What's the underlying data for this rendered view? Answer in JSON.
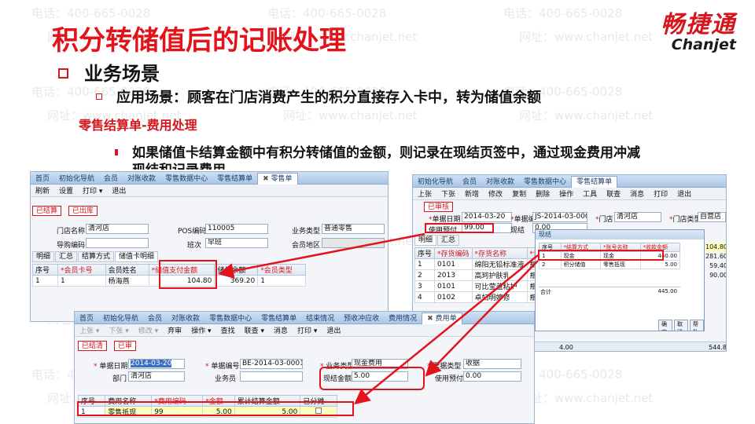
{
  "slide": {
    "title": "积分转储值后的记账处理",
    "section_heading": "业务场景",
    "scenario": "应用场景：顾客在门店消费产生的积分直接存入卡中，转为储值余额",
    "subheading": "零售结算单-费用处理",
    "note_line1": "如果储值卡结算金额中有积分转储值的金额，则记录在现结页签中，通过现金费用冲减",
    "note_line2": "现结和记录费用。"
  },
  "logo": {
    "cn": "畅捷通",
    "en": "Chanjet"
  },
  "watermark": {
    "phone": "电话：400-665-0028",
    "web": "网址：www.chanjet.net"
  },
  "win1": {
    "tabs": [
      "首页",
      "初始化导航",
      "会员",
      "对账收款",
      "零售数据中心",
      "零售结算单",
      "零售单"
    ],
    "close_mark": "✖",
    "toolbar": [
      "刷新",
      "设置",
      "打印 ▾",
      "退出"
    ],
    "stamps": [
      "已结算",
      "已出库"
    ],
    "labels": {
      "store": "门店名称",
      "guide": "导购编码",
      "pos": "POS编码",
      "shift": "班次",
      "biz": "业务类型",
      "member": "会员地区"
    },
    "values": {
      "store": "清河店",
      "pos": "110005",
      "shift": "早班",
      "biz": "普通零售"
    },
    "subtabs": [
      "明细",
      "汇总",
      "结算方式",
      "储值卡明细"
    ],
    "grid_headers": [
      "序号",
      "*会员卡号",
      "会员姓名",
      "*储值支付金额",
      "储值余额",
      "*会员类型"
    ],
    "grid_row": [
      "1",
      "1",
      "杨海燕",
      "104.80",
      "369.20",
      "1"
    ]
  },
  "win2": {
    "tabs": [
      "首页",
      "初始化导航",
      "会员",
      "对账收款",
      "零售数据中心",
      "零售结算单",
      "结束情况",
      "预收冲应收",
      "费用情况",
      "费用单"
    ],
    "toolbar": [
      "上张 ▾",
      "下张 ▾",
      "修改 ▾",
      "弃审",
      "操作 ▾",
      "查找",
      "联查 ▾",
      "消息",
      "打印 ▾",
      "退出"
    ],
    "stamps": [
      "已结清",
      "已审"
    ],
    "labels": {
      "date": "单据日期",
      "dept": "部门",
      "code": "单据编号",
      "staff": "业务员",
      "biz": "业务类型",
      "settle": "现结金额",
      "bill": "票据类型",
      "prepay": "使用预付"
    },
    "values": {
      "date": "2014-03-20",
      "dept": "清河店",
      "code": "BE-2014-03-0001",
      "biz": "现金费用",
      "settle": "5.00",
      "bill": "收据",
      "prepay": "0.00"
    },
    "grid_headers": [
      "序号",
      "费用名称",
      "*费用编码",
      "*金额",
      "累计结算金额",
      "已分摊"
    ],
    "grid_row": [
      "1",
      "零售抵现",
      "99",
      "5.00",
      "5.00",
      ""
    ]
  },
  "win3": {
    "tabs": [
      "初始化导航",
      "会员",
      "对账收款",
      "零售数据中心",
      "零售结算单"
    ],
    "toolbar": [
      "上张",
      "下张",
      "新增",
      "修改",
      "复制",
      "删除",
      "操作",
      "工具",
      "联查",
      "消息",
      "打印",
      "退出"
    ],
    "stamps": [
      "已审核"
    ],
    "labels": {
      "date": "单据日期",
      "code": "单据编号",
      "store": "门店",
      "pay": "使用预付",
      "settle": "现结",
      "shop_type": "门店类型"
    },
    "values": {
      "date": "2014-03-20",
      "code": "JS-2014-03-0005",
      "store": "清河店",
      "pay": "99.00",
      "settle": "0.00",
      "shop_type": "自营店"
    },
    "subtabs": [
      "明细",
      "汇总"
    ],
    "grid_headers": [
      "序号",
      "*存货编码",
      "*存货名称",
      "*计量单位"
    ],
    "grid_rows": [
      [
        "1",
        "0101",
        "绵阳无铅标准液",
        "瓶"
      ],
      [
        "2",
        "2013",
        "高珂护肤乳",
        "瓶"
      ],
      [
        "3",
        "0101",
        "可比莹盖粘护",
        "瓶"
      ],
      [
        "4",
        "0102",
        "卓妇明婷修",
        "瓶"
      ]
    ],
    "right_values": [
      "104.80",
      "281.60",
      "59.40",
      "90.00"
    ],
    "footer_total": "合计",
    "footer_values": [
      "4.00",
      "544.80"
    ]
  },
  "dialog": {
    "title": "现结",
    "headers": [
      "序号",
      "*结算方式",
      "*账号名称",
      "*收款金额"
    ],
    "rows": [
      [
        "1",
        "现金",
        "现金",
        "440.00"
      ],
      [
        "2",
        "积分储值",
        "零售抵现",
        "5.00"
      ]
    ],
    "total_label": "合计",
    "total_value": "445.00",
    "buttons": [
      "确定",
      "取消",
      "帮助"
    ]
  }
}
